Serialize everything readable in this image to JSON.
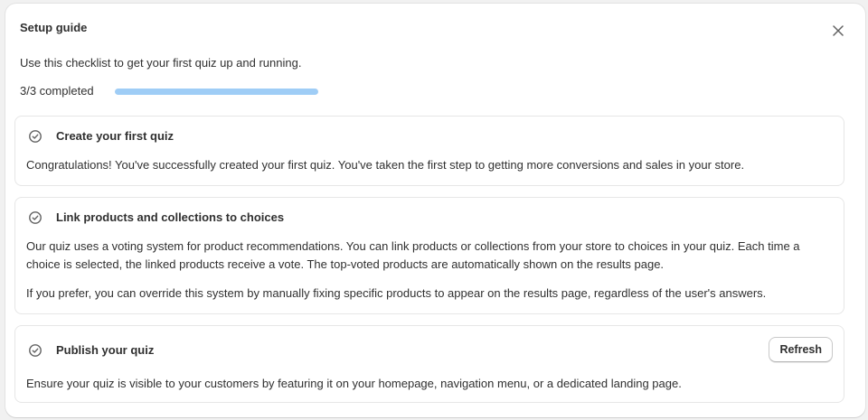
{
  "guide": {
    "title": "Setup guide",
    "subtitle": "Use this checklist to get your first quiz up and running.",
    "progress": {
      "label": "3/3 completed",
      "completed": 3,
      "total": 3,
      "fill_color": "#9fcdf6"
    },
    "close_icon": "close-icon"
  },
  "steps": [
    {
      "title": "Create your first quiz",
      "icon": "check-circle-icon",
      "paragraphs": [
        "Congratulations! You've successfully created your first quiz. You've taken the first step to getting more conversions and sales in your store."
      ]
    },
    {
      "title": "Link products and collections to choices",
      "icon": "check-circle-icon",
      "paragraphs": [
        "Our quiz uses a voting system for product recommendations. You can link products or collections from your store to choices in your quiz. Each time a choice is selected, the linked products receive a vote. The top-voted products are automatically shown on the results page.",
        "If you prefer, you can override this system by manually fixing specific products to appear on the results page, regardless of the user's answers."
      ]
    },
    {
      "title": "Publish your quiz",
      "icon": "check-circle-icon",
      "button_label": "Refresh",
      "paragraphs": [
        "Ensure your quiz is visible to your customers by featuring it on your homepage, navigation menu, or a dedicated landing page."
      ]
    }
  ]
}
